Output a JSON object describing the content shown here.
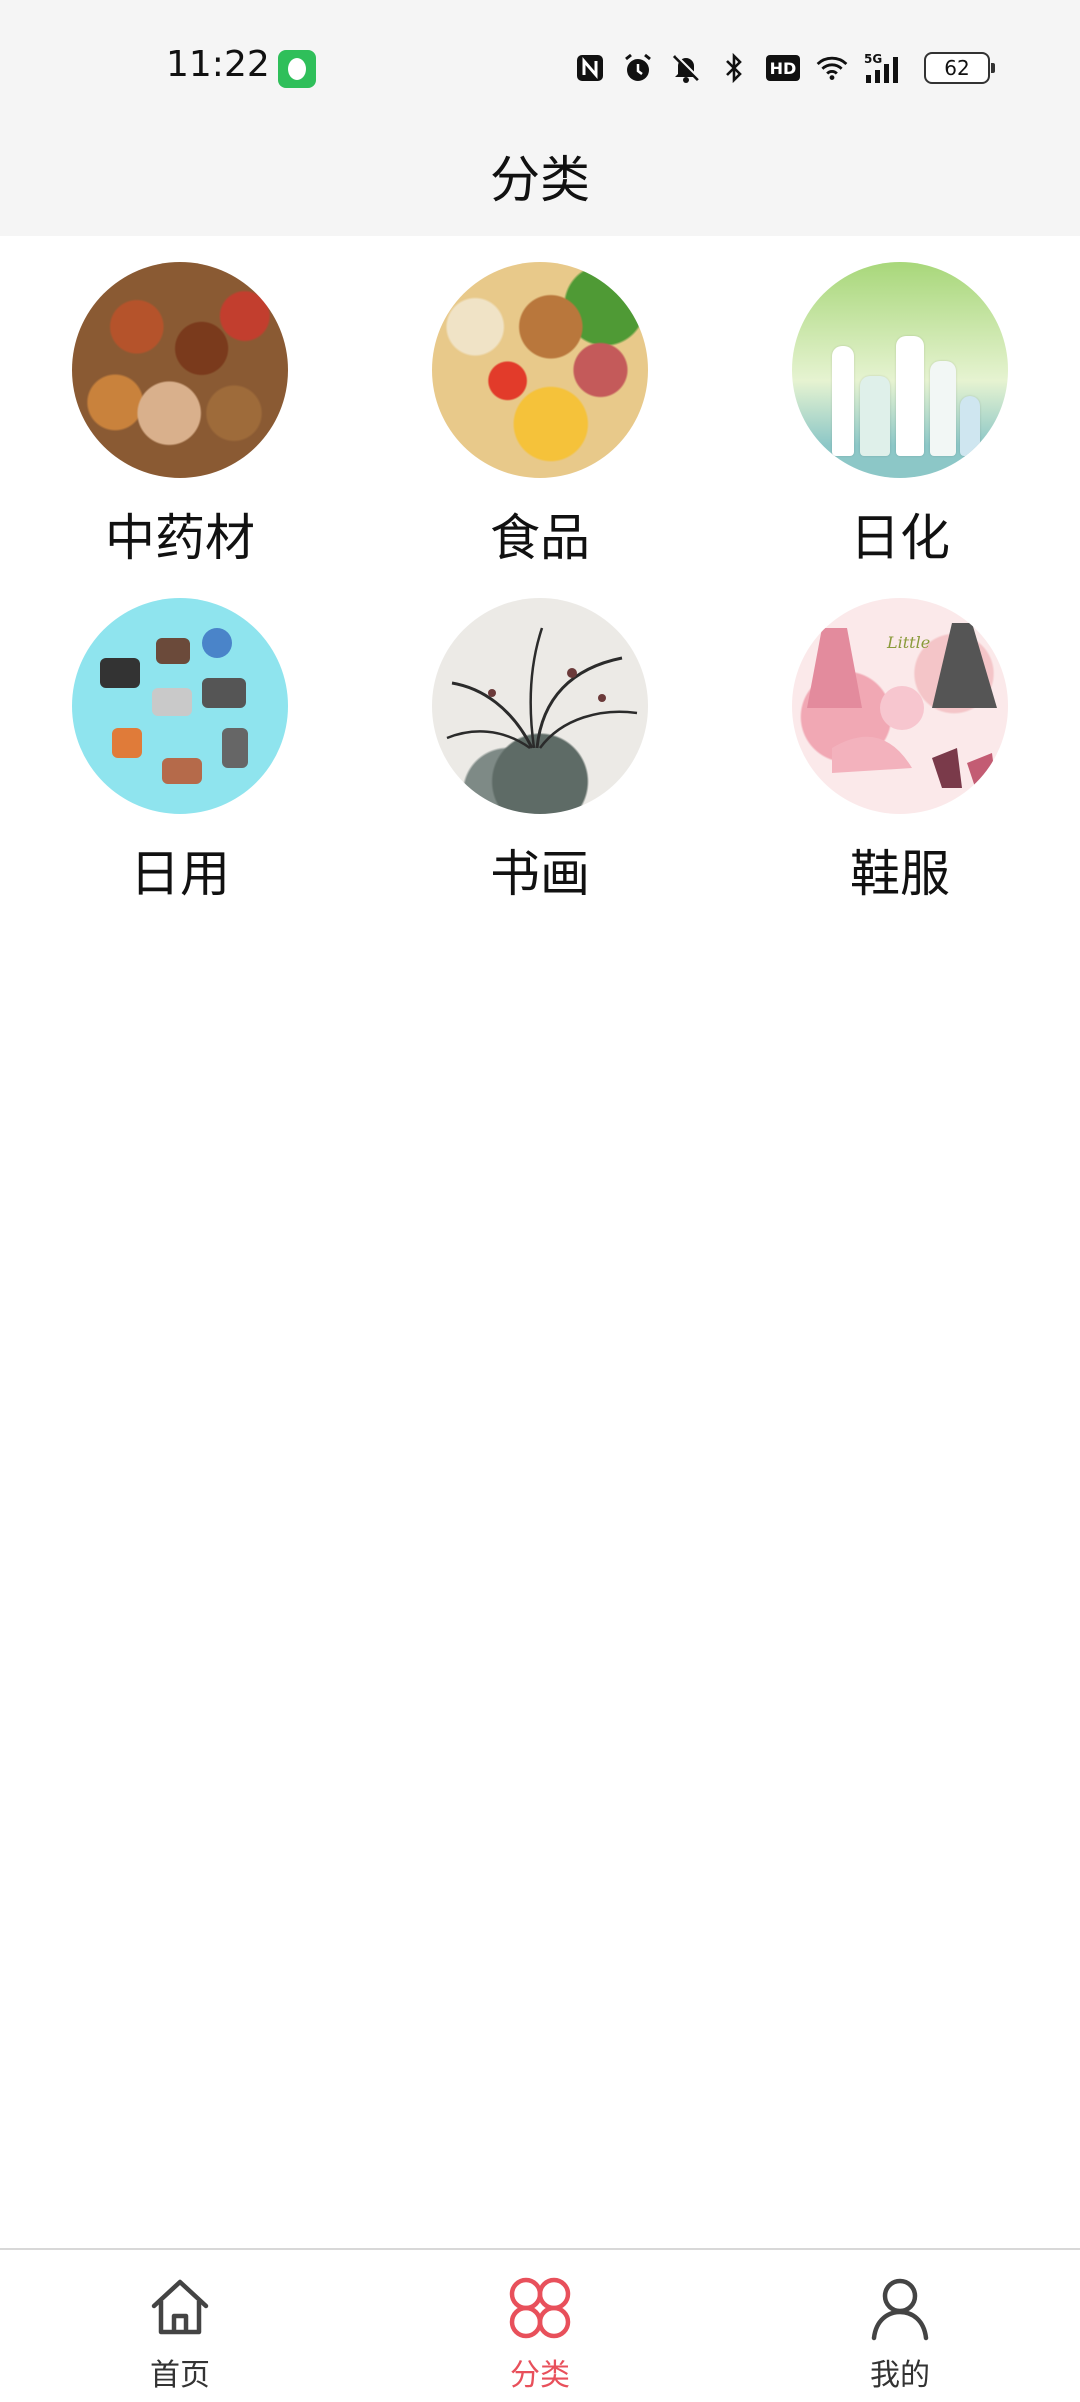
{
  "status_bar": {
    "time": "11:22",
    "battery": "62",
    "network": "5G",
    "hd": "HD"
  },
  "header": {
    "title": "分类"
  },
  "categories": [
    {
      "label": "中药材",
      "image": "chinese-herbs"
    },
    {
      "label": "食品",
      "image": "food"
    },
    {
      "label": "日化",
      "image": "cosmetics"
    },
    {
      "label": "日用",
      "image": "daily-goods"
    },
    {
      "label": "书画",
      "image": "ink-painting"
    },
    {
      "label": "鞋服",
      "image": "shoes-clothing"
    }
  ],
  "bottom_nav": {
    "items": [
      {
        "label": "首页",
        "icon": "home-icon",
        "active": false
      },
      {
        "label": "分类",
        "icon": "category-icon",
        "active": true
      },
      {
        "label": "我的",
        "icon": "profile-icon",
        "active": false
      }
    ],
    "active_color": "#e8505b",
    "inactive_color": "#333333"
  }
}
